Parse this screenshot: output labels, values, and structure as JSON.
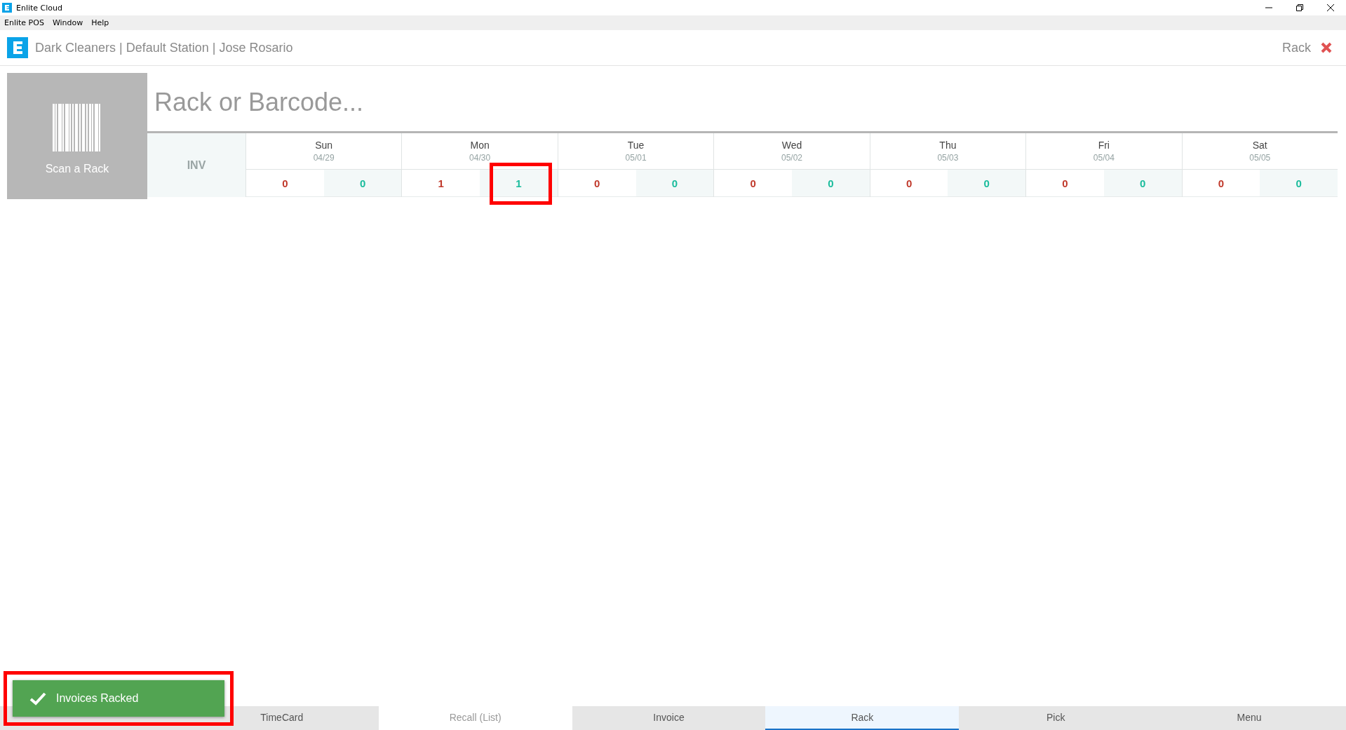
{
  "window": {
    "title": "Enlite Cloud"
  },
  "menu": [
    "Enlite POS",
    "Window",
    "Help"
  ],
  "header": {
    "title": "Dark Cleaners | Default Station | Jose Rosario",
    "section": "Rack"
  },
  "scan": {
    "label": "Scan a Rack",
    "placeholder": "Rack or Barcode..."
  },
  "inv_label": "INV",
  "days": [
    {
      "day": "Sun",
      "date": "04/29",
      "cells": [
        {
          "value": "0",
          "kind": "pending",
          "highlighted": false
        },
        {
          "value": "0",
          "kind": "racked",
          "highlighted": false
        }
      ]
    },
    {
      "day": "Mon",
      "date": "04/30",
      "cells": [
        {
          "value": "1",
          "kind": "pending",
          "highlighted": false
        },
        {
          "value": "1",
          "kind": "racked",
          "highlighted": true
        }
      ]
    },
    {
      "day": "Tue",
      "date": "05/01",
      "cells": [
        {
          "value": "0",
          "kind": "pending",
          "highlighted": false
        },
        {
          "value": "0",
          "kind": "racked",
          "highlighted": false
        }
      ]
    },
    {
      "day": "Wed",
      "date": "05/02",
      "cells": [
        {
          "value": "0",
          "kind": "pending",
          "highlighted": false
        },
        {
          "value": "0",
          "kind": "racked",
          "highlighted": false
        }
      ]
    },
    {
      "day": "Thu",
      "date": "05/03",
      "cells": [
        {
          "value": "0",
          "kind": "pending",
          "highlighted": false
        },
        {
          "value": "0",
          "kind": "racked",
          "highlighted": false
        }
      ]
    },
    {
      "day": "Fri",
      "date": "05/04",
      "cells": [
        {
          "value": "0",
          "kind": "pending",
          "highlighted": false
        },
        {
          "value": "0",
          "kind": "racked",
          "highlighted": false
        }
      ]
    },
    {
      "day": "Sat",
      "date": "05/05",
      "cells": [
        {
          "value": "0",
          "kind": "pending",
          "highlighted": false
        },
        {
          "value": "0",
          "kind": "racked",
          "highlighted": false
        }
      ]
    }
  ],
  "toast": {
    "message": "Invoices Racked",
    "highlighted": true
  },
  "tabs": [
    {
      "label": "TimeCard",
      "selected": false,
      "disabled": false
    },
    {
      "label": "Recall (List)",
      "selected": false,
      "disabled": true
    },
    {
      "label": "Invoice",
      "selected": false,
      "disabled": false
    },
    {
      "label": "Rack",
      "selected": true,
      "disabled": false
    },
    {
      "label": "Pick",
      "selected": false,
      "disabled": false
    },
    {
      "label": "Menu",
      "selected": false,
      "disabled": false
    }
  ]
}
